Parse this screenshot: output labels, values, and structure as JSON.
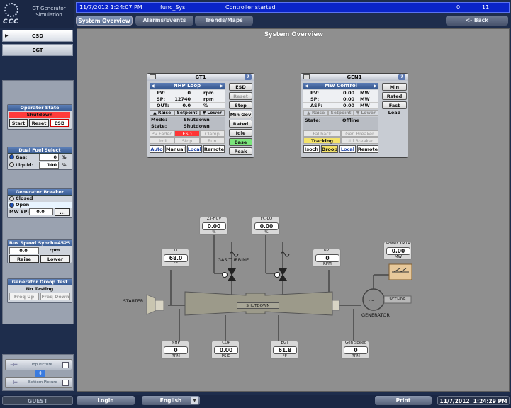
{
  "app": {
    "title_line1": "GT Generator",
    "title_line2": "Simulation",
    "logo": "CCC"
  },
  "topbar": {
    "datetime": "11/7/2012 1:24:07 PM",
    "controller": "func_Sys",
    "message": "Controller started",
    "count_a": "0",
    "count_b": "11"
  },
  "tabs": [
    {
      "label": "System Overview"
    },
    {
      "label": "Alarms/Events"
    },
    {
      "label": "Trends/Maps"
    }
  ],
  "back_label": "<- Back",
  "left_nav": [
    {
      "label": "CSD"
    },
    {
      "label": "EGT"
    }
  ],
  "operator_state": {
    "title": "Operator State",
    "state": "Shutdown",
    "start": "Start",
    "reset": "Reset",
    "esd": "ESD"
  },
  "dual_fuel": {
    "title": "Dual Fuel Select",
    "gas_label": "Gas:",
    "gas_value": "0",
    "gas_unit": "%",
    "liquid_label": "Liquid:",
    "liquid_value": "100",
    "liquid_unit": "%"
  },
  "gen_breaker": {
    "title": "Generator Breaker",
    "closed": "Closed",
    "open": "Open",
    "mwsp_label": "MW SP:",
    "mwsp_value": "0.0",
    "more": "..."
  },
  "bus_speed": {
    "title": "Bus Speed Synch=4525",
    "value": "0.0",
    "unit": "rpm",
    "raise": "Raise",
    "lower": "Lower"
  },
  "droop_test": {
    "title": "Generator Droop Test",
    "status": "No Testing",
    "freq_up": "Freq Up",
    "freq_down": "Freq Down"
  },
  "pictures": {
    "top": "Top Picture",
    "bottom": "Bottom Picture"
  },
  "main_title": "System Overview",
  "gt1": {
    "title": "GT1",
    "help": "?",
    "loop": "NHP Loop",
    "pv_label": "PV:",
    "pv_value": "0",
    "pv_unit": "rpm",
    "sp_label": "SP:",
    "sp_value": "12740",
    "sp_unit": "rpm",
    "out_label": "OUT:",
    "out_value": "0.0",
    "out_unit": "%",
    "raise": "Raise",
    "setpoint": "Setpoint",
    "lower": "Lower",
    "mode_label": "Mode:",
    "mode_value": "Shutdown",
    "state_label": "State:",
    "state_value": "Shutdown",
    "pv_faded": "PV Faded",
    "esd": "ESD",
    "clamp": "Clamp",
    "limit": "Limit",
    "stop": "Stop",
    "run": "Run",
    "auto": "Auto",
    "manual": "Manual",
    "local": "Local",
    "remote": "Remote",
    "side": [
      "ESD",
      "Reset",
      "Stop",
      "Min Gov",
      "Rated",
      "Idle",
      "Base",
      "Peak"
    ]
  },
  "gen1": {
    "title": "GEN1",
    "help": "?",
    "loop": "MW Control",
    "pv_label": "PV:",
    "pv_value": "0.00",
    "pv_unit": "MW",
    "sp_label": "SP:",
    "sp_value": "0.00",
    "sp_unit": "MW",
    "asp_label": "ASP:",
    "asp_value": "0.00",
    "asp_unit": "MW",
    "raise": "Raise",
    "setpoint": "Setpoint",
    "lower": "Lower",
    "state_label": "State:",
    "state_value": "Offline",
    "fallback": "Fallback",
    "gen_breaker": "Gen Breaker",
    "tracking": "Tracking",
    "util_breaker": "Util Breaker",
    "isoch": "Isoch",
    "droop": "Droop",
    "local": "Local",
    "remote": "Remote",
    "side": [
      "Min",
      "Rated",
      "Fast Load"
    ]
  },
  "diagram": {
    "zt_hcv": {
      "tag": "ZT-HCV",
      "value": "0.00",
      "unit": "%"
    },
    "fc_lq": {
      "tag": "FC-LQ",
      "value": "0.00",
      "unit": "%"
    },
    "t1": {
      "tag": "T1",
      "value": "68.0",
      "unit": "°F"
    },
    "npt": {
      "tag": "NPT",
      "value": "0",
      "unit": "RPM"
    },
    "power": {
      "tag": "Power XMTR",
      "value": "0.00",
      "unit": "MW"
    },
    "starter": "STARTER",
    "gas_turbine": "GAS TURBINE",
    "shutdown": "SHUTDOWN",
    "offline": "OFFLINE",
    "generator": "GENERATOR",
    "nhp": {
      "tag": "NHP",
      "value": "0",
      "unit": "RPM"
    },
    "cdp": {
      "tag": "CDP",
      "value": "0.00",
      "unit": "PSIG"
    },
    "egt": {
      "tag": "EGT",
      "value": "61.8",
      "unit": "°F"
    },
    "gen_speed": {
      "tag": "Gen Speed",
      "value": "0",
      "unit": "RPM"
    }
  },
  "bottom": {
    "user": "GUEST",
    "login": "Login",
    "language": "English",
    "print": "Print",
    "date": "11/7/2012",
    "time": "1:24:29 PM"
  }
}
